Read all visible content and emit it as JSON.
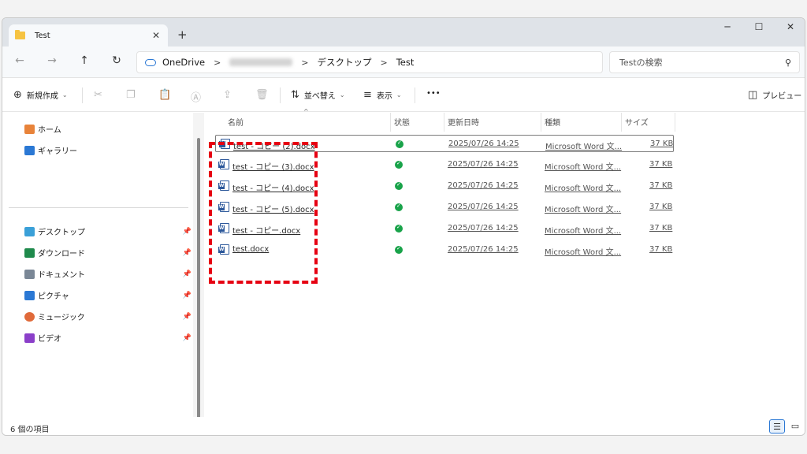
{
  "tab": {
    "title": "Test",
    "icon": "folder-icon"
  },
  "window_controls": {
    "minimize": "─",
    "maximize": "☐",
    "close": "✕",
    "new_tab": "+",
    "tab_close": "✕"
  },
  "nav": {
    "back": "←",
    "forward": "→",
    "up": "↑",
    "refresh": "↻"
  },
  "address": {
    "segments": [
      "OneDrive",
      "デスクトップ",
      "Test"
    ],
    "separator": ">"
  },
  "search": {
    "placeholder": "Testの検索",
    "icon": "search-icon"
  },
  "toolbar": {
    "new_label": "新規作成",
    "sort_label": "並べ替え",
    "view_label": "表示",
    "more_label": "•••",
    "preview_label": "プレビュー",
    "icons": [
      "cut-icon",
      "copy-icon",
      "paste-icon",
      "rename-icon",
      "share-icon",
      "delete-icon"
    ]
  },
  "sidebar": {
    "top_items": [
      {
        "label": "ホーム",
        "icon": "home-icon",
        "color": "#e8833a"
      },
      {
        "label": "ギャラリー",
        "icon": "gallery-icon",
        "color": "#2b78d4"
      }
    ],
    "pinned_items": [
      {
        "label": "デスクトップ",
        "icon": "desktop-icon",
        "color": "#3aa0d8"
      },
      {
        "label": "ダウンロード",
        "icon": "download-icon",
        "color": "#1f8a4c"
      },
      {
        "label": "ドキュメント",
        "icon": "documents-icon",
        "color": "#7a8796"
      },
      {
        "label": "ピクチャ",
        "icon": "pictures-icon",
        "color": "#2b78d4"
      },
      {
        "label": "ミュージック",
        "icon": "music-icon",
        "color": "#e06a3a"
      },
      {
        "label": "ビデオ",
        "icon": "videos-icon",
        "color": "#8b3fc9"
      }
    ]
  },
  "columns": {
    "name": "名前",
    "status": "状態",
    "modified": "更新日時",
    "type": "種類",
    "size": "サイズ"
  },
  "files": [
    {
      "name": "test - コピー (2).docx",
      "modified": "2025/07/26 14:25",
      "type": "Microsoft Word 文...",
      "size": "37 KB"
    },
    {
      "name": "test - コピー (3).docx",
      "modified": "2025/07/26 14:25",
      "type": "Microsoft Word 文...",
      "size": "37 KB"
    },
    {
      "name": "test - コピー (4).docx",
      "modified": "2025/07/26 14:25",
      "type": "Microsoft Word 文...",
      "size": "37 KB"
    },
    {
      "name": "test - コピー (5).docx",
      "modified": "2025/07/26 14:25",
      "type": "Microsoft Word 文...",
      "size": "37 KB"
    },
    {
      "name": "test - コピー.docx",
      "modified": "2025/07/26 14:25",
      "type": "Microsoft Word 文...",
      "size": "37 KB"
    },
    {
      "name": "test.docx",
      "modified": "2025/07/26 14:25",
      "type": "Microsoft Word 文...",
      "size": "37 KB"
    }
  ],
  "statusbar": {
    "item_count": "6 個の項目"
  },
  "colors": {
    "accent": "#2b78d4",
    "highlight": "#e60012",
    "synced": "#19a34a"
  }
}
